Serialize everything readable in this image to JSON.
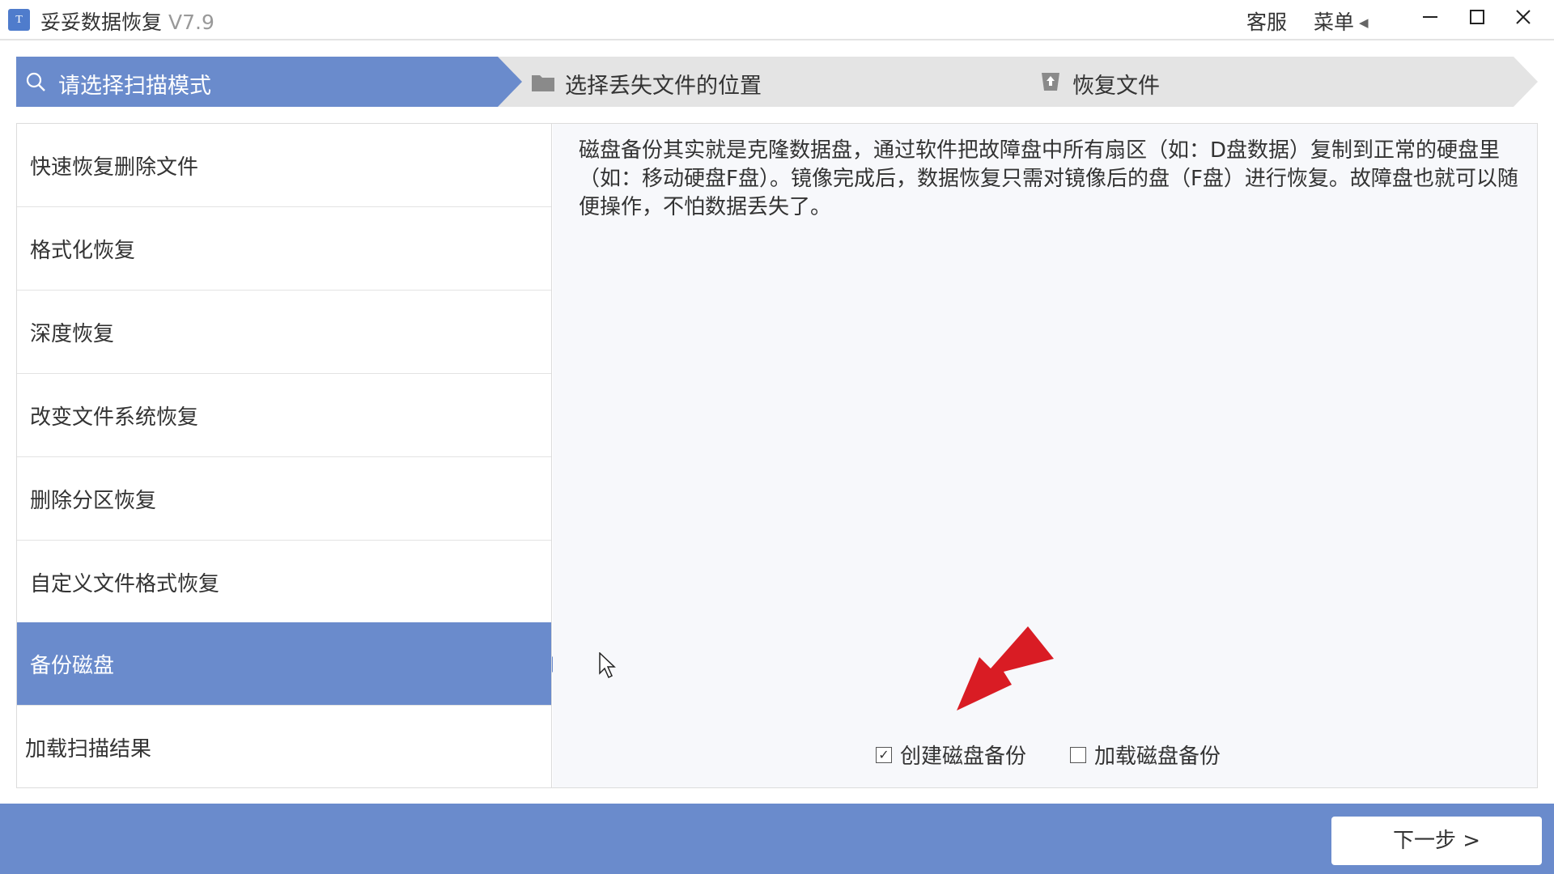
{
  "app": {
    "title": "妥妥数据恢复",
    "version": "V7.9",
    "icon_text": "T"
  },
  "titlebar": {
    "support_label": "客服",
    "menu_label": "菜单",
    "menu_arrow": "◀",
    "minimize_glyph": "—",
    "maximize_glyph": "☐",
    "close_glyph": "✕"
  },
  "steps": [
    {
      "label": "请选择扫描模式",
      "icon": "search-icon",
      "active": true
    },
    {
      "label": "选择丢失文件的位置",
      "icon": "folder-icon",
      "active": false
    },
    {
      "label": "恢复文件",
      "icon": "restore-icon",
      "active": false
    }
  ],
  "sidebar": {
    "items": [
      {
        "label": "快速恢复删除文件"
      },
      {
        "label": "格式化恢复"
      },
      {
        "label": "深度恢复"
      },
      {
        "label": "改变文件系统恢复"
      },
      {
        "label": "删除分区恢复"
      },
      {
        "label": "自定义文件格式恢复"
      },
      {
        "label": "备份磁盘",
        "active": true
      },
      {
        "label": "加载扫描结果"
      }
    ]
  },
  "content": {
    "description": "磁盘备份其实就是克隆数据盘，通过软件把故障盘中所有扇区（如：D盘数据）复制到正常的硬盘里（如：移动硬盘F盘）。镜像完成后，数据恢复只需对镜像后的盘（F盘）进行恢复。故障盘也就可以随便操作，不怕数据丢失了。",
    "options": [
      {
        "label": "创建磁盘备份",
        "checked": true
      },
      {
        "label": "加载磁盘备份",
        "checked": false
      }
    ]
  },
  "footer": {
    "next_label": "下一步 >"
  },
  "colors": {
    "accent": "#6a8bcc",
    "step_inactive": "#e4e4e4",
    "annotation_arrow": "#d91c24"
  }
}
